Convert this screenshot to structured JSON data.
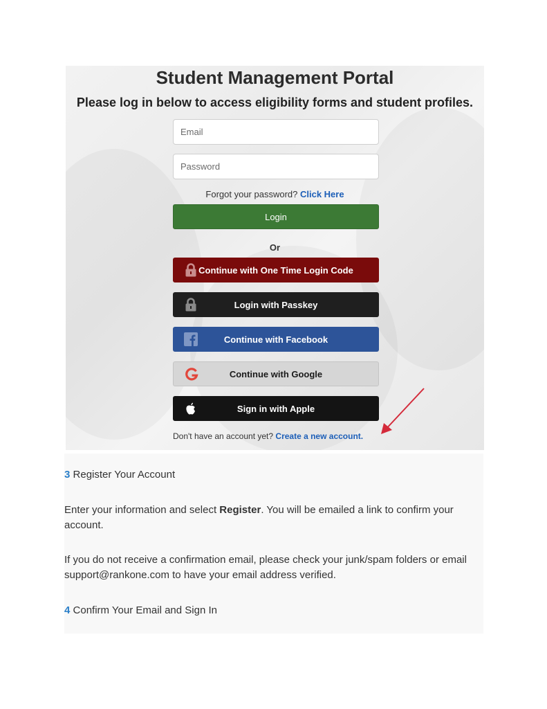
{
  "portal": {
    "title": "Student Management Portal",
    "subtitle": "Please log in below to access eligibility forms and student profiles.",
    "email_placeholder": "Email",
    "password_placeholder": "Password",
    "forgot_text": "Forgot your password?",
    "forgot_link": "Click Here",
    "login_label": "Login",
    "or_label": "Or",
    "buttons": {
      "otp": {
        "label": "Continue with One Time Login Code",
        "icon": "lock-icon",
        "color": "#7a0b0b"
      },
      "passkey": {
        "label": "Login with Passkey",
        "icon": "lock-icon",
        "color": "#1f1f1f"
      },
      "facebook": {
        "label": "Continue with Facebook",
        "icon": "facebook-icon",
        "color": "#2d5499"
      },
      "google": {
        "label": "Continue with Google",
        "icon": "google-icon",
        "color": "#d6d6d6"
      },
      "apple": {
        "label": "Sign in with Apple",
        "icon": "apple-icon",
        "color": "#141414"
      }
    },
    "signup_text": "Don't have an account yet?",
    "signup_link": "Create a new account."
  },
  "article": {
    "step3": {
      "number": "3",
      "title": "Register Your Account"
    },
    "para1": {
      "before": "Enter your information and select ",
      "bold": "Register",
      "after": ". You will be emailed a link to confirm your account."
    },
    "para2": "If you do not receive a confirmation email, please check your junk/spam folders or email support@rankone.com to have your email address verified.",
    "step4": {
      "number": "4",
      "title": "Confirm Your Email and Sign In"
    }
  },
  "colors": {
    "link": "#1d5fb8",
    "login_button": "#3c7a35",
    "step_number": "#2a7fc9",
    "annotation_arrow": "#d42a3a"
  }
}
